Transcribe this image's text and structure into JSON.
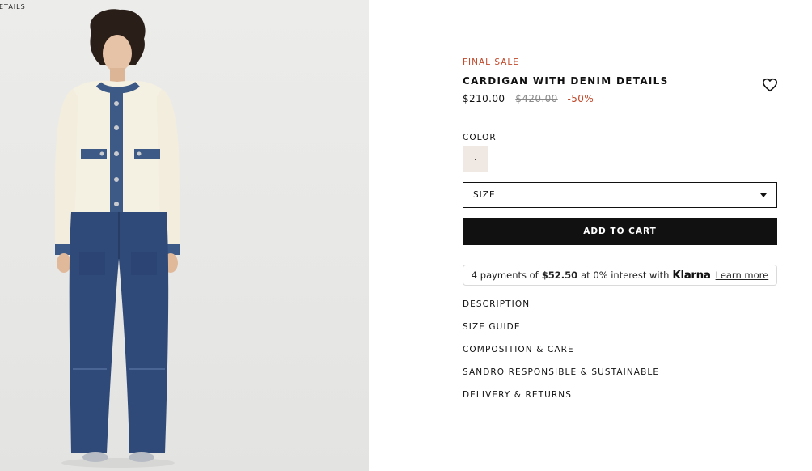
{
  "photo": {
    "corner_label": "ETAILS"
  },
  "product": {
    "badge": "FINAL SALE",
    "title": "CARDIGAN WITH DENIM DETAILS",
    "price_current": "$210.00",
    "price_original": "$420.00",
    "discount": "-50%",
    "wishlist_icon": "heart-outline-icon"
  },
  "color": {
    "label": "COLOR",
    "selected_swatch": "#efe8e3"
  },
  "size": {
    "label": "SIZE",
    "icon": "caret-down-icon"
  },
  "cart": {
    "add_label": "ADD TO CART"
  },
  "klarna": {
    "prefix": "4 payments of",
    "amount": "$52.50",
    "middle": "at 0% interest with",
    "brand": "Klarna",
    "learn_more": "Learn more"
  },
  "accordion": [
    {
      "label": "DESCRIPTION"
    },
    {
      "label": "SIZE GUIDE"
    },
    {
      "label": "COMPOSITION & CARE"
    },
    {
      "label": "SANDRO RESPONSIBLE & SUSTAINABLE"
    },
    {
      "label": "DELIVERY & RETURNS"
    }
  ],
  "colors": {
    "sale_red": "#c0492b",
    "button_black": "#111111",
    "denim": "#2f4a78",
    "cardigan_cream": "#f4f0e2"
  }
}
